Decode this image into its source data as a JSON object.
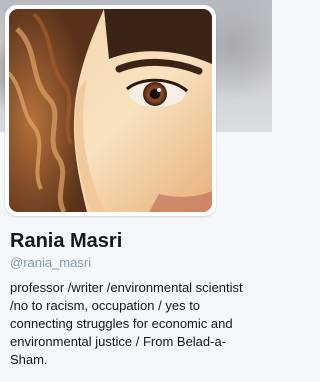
{
  "profile": {
    "name": "Rania Masri",
    "handle": "@rania_masri",
    "bio_lines": [
      "professor /writer /environmental scientist",
      "/no to racism, occupation / yes to",
      "connecting struggles for economic and",
      "environmental justice / From Belad-a-",
      "Sham."
    ]
  },
  "colors": {
    "name_text": "#14171a",
    "handle_text": "#8899a6",
    "page_background": "#f5f8fa"
  }
}
